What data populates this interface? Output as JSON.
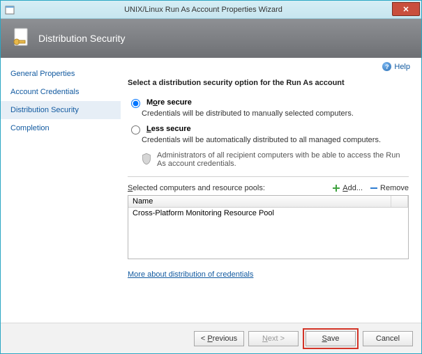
{
  "window": {
    "title": "UNIX/Linux Run As Account Properties Wizard"
  },
  "banner": {
    "heading": "Distribution Security"
  },
  "nav": {
    "items": [
      {
        "label": "General Properties"
      },
      {
        "label": "Account Credentials"
      },
      {
        "label": "Distribution Security"
      },
      {
        "label": "Completion"
      }
    ],
    "active_index": 2
  },
  "help": {
    "label": "Help"
  },
  "content": {
    "instruction": "Select a distribution security option for the Run As account",
    "options": {
      "more_secure": {
        "title_pre": "M",
        "title_accel": "o",
        "title_post": "re secure",
        "desc": "Credentials will be distributed to manually selected computers."
      },
      "less_secure": {
        "title_pre": "",
        "title_accel": "L",
        "title_post": "ess secure",
        "desc": "Credentials will be automatically distributed to all managed computers."
      }
    },
    "selected_option": "more_secure",
    "admin_note": "Administrators of all recipient computers with be able to access the Run As account credentials.",
    "list": {
      "label_pre": "",
      "label_accel": "S",
      "label_post": "elected computers and resource pools:",
      "add_label": "Add...",
      "remove_label": "Remove",
      "columns": {
        "name": "Name"
      },
      "rows": [
        {
          "name": "Cross-Platform Monitoring Resource Pool"
        }
      ]
    },
    "more_link": "More about distribution of credentials"
  },
  "footer": {
    "previous": "< Previous",
    "next": "Next >",
    "save": "Save",
    "cancel": "Cancel"
  }
}
